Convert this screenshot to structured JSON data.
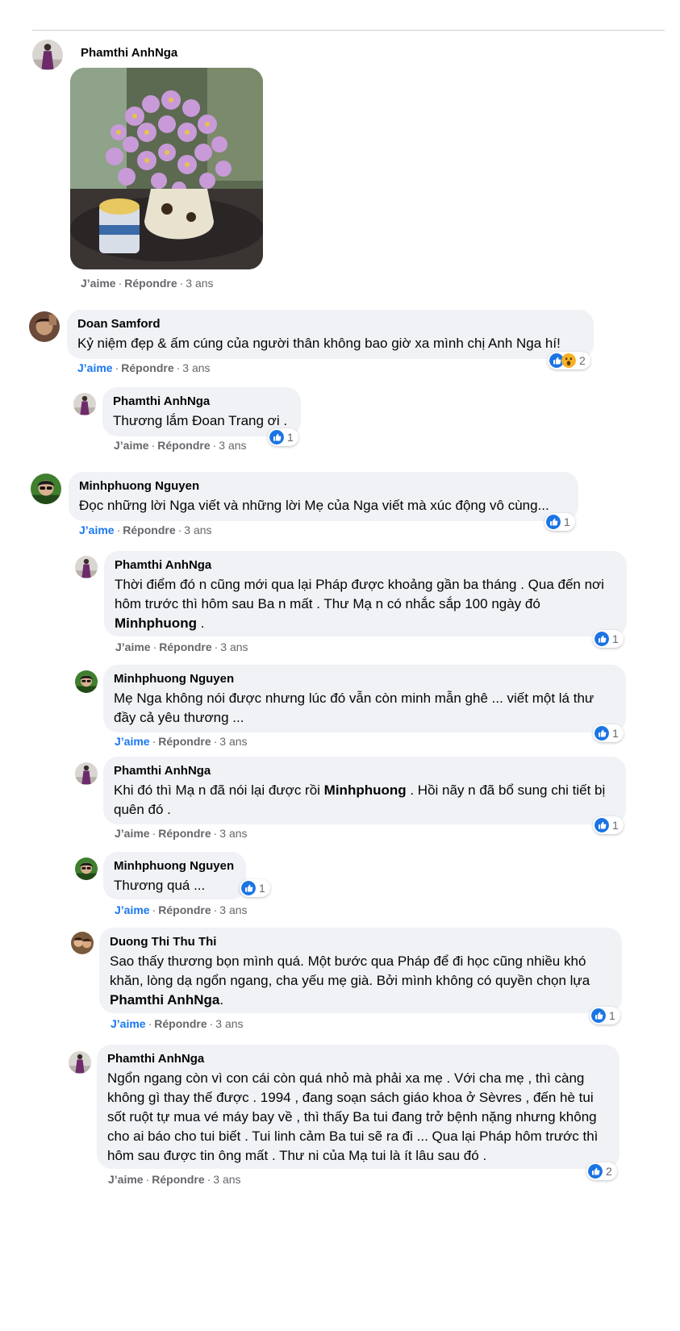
{
  "labels": {
    "like": "J’aime",
    "reply": "Répondre",
    "sep": "·"
  },
  "comments": [
    {
      "author": "Phamthi AnhNga",
      "time": "3 ans"
    },
    {
      "author": "Doan Samford",
      "text": "Kỷ niệm đẹp & ấm cúng của người thân không bao giờ xa mình chị Anh Nga hí!",
      "time": "3 ans",
      "reactions": 2
    },
    {
      "author": "Phamthi AnhNga",
      "text": "Thương lắm Đoan Trang ơi .",
      "time": "3 ans",
      "reactions": 1
    },
    {
      "author": "Minhphuong Nguyen",
      "text": "Đọc những lời Nga viết và những lời Mẹ của Nga viết mà xúc động vô cùng...",
      "time": "3 ans",
      "reactions": 1
    },
    {
      "author": "Phamthi AnhNga",
      "text_pre": "Thời điểm đó n cũng mới qua lại Pháp được khoảng gần ba tháng . Qua đến nơi hôm trước thì hôm sau Ba n mất . Thư Mạ n có nhắc sắp 100 ngày đó",
      "mention": "Minhphuong",
      "text_post": " .",
      "time": "3 ans",
      "reactions": 1
    },
    {
      "author": "Minhphuong Nguyen",
      "text": "Mẹ Nga không nói được nhưng lúc đó vẫn còn minh mẫn ghê ... viết một lá thư đầy cả yêu thương ...",
      "time": "3 ans",
      "reactions": 1
    },
    {
      "author": "Phamthi AnhNga",
      "text_pre": "Khi đó thì Mạ n đã nói lại được rồi ",
      "mention": "Minhphuong",
      "text_post": " . Hồi nãy n đã bổ sung chi tiết bị quên đó .",
      "time": "3 ans",
      "reactions": 1
    },
    {
      "author": "Minhphuong Nguyen",
      "text": "Thương quá ...",
      "time": "3 ans",
      "reactions": 1
    },
    {
      "author": "Duong Thi Thu Thi",
      "text_pre": "Sao thấy thương bọn mình quá. Một bước qua Pháp để đi học cũng nhiều khó khăn, lòng dạ ngổn ngang, cha yếu mẹ già. Bởi mình không có quyền chọn lựa ",
      "mention": "Phamthi AnhNga",
      "text_post": ".",
      "time": "3 ans",
      "reactions": 1
    },
    {
      "author": "Phamthi AnhNga",
      "text": "Ngổn ngang còn vì con cái còn quá nhỏ mà phải xa mẹ . Với cha mẹ , thì càng không gì thay thế được . 1994 , đang soạn sách giáo khoa ở Sèvres , đến hè tui sốt ruột tự mua vé máy bay về , thì thấy Ba tui đang trở bệnh nặng nhưng không cho ai báo cho tui biết . Tui linh cảm Ba tui sẽ ra đi ... Qua lại Pháp hôm trước thì hôm sau được tin ông mất . Thư ni của Mạ tui là ít lâu sau đó .",
      "time": "3 ans",
      "reactions": 2
    }
  ],
  "colors": {
    "bubble": "#f0f2f5",
    "like_blue": "#1877f2",
    "meta_gray": "#65676b",
    "divider": "#ced0d4"
  },
  "icons": {
    "like": "thumbs-up-icon",
    "wow": "wow-face-icon"
  }
}
